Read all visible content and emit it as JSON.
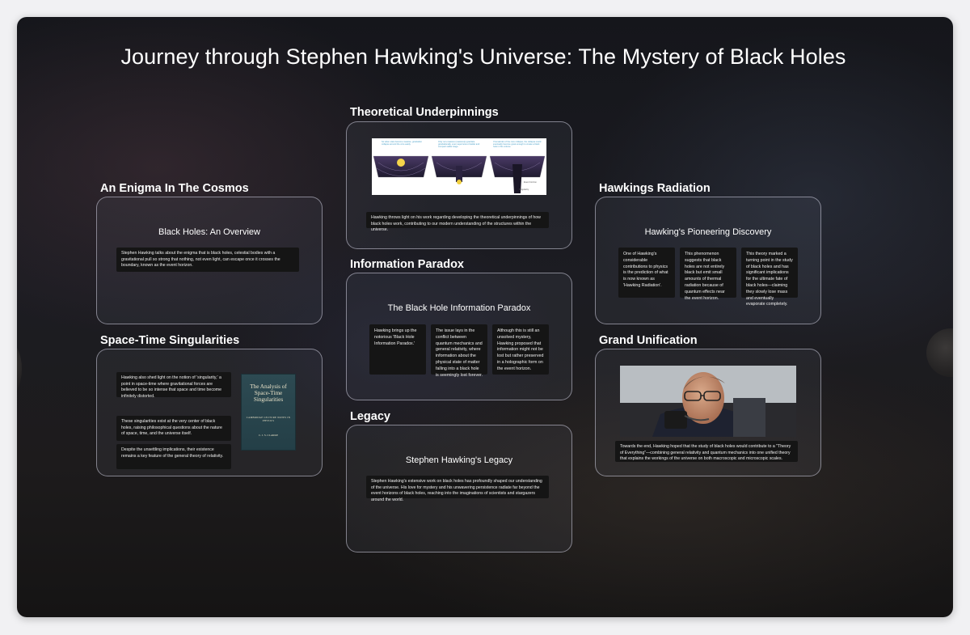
{
  "title": "Journey through Stephen Hawking's Universe: The Mystery of Black Holes",
  "frames": {
    "enigma": {
      "title": "An Enigma In The Cosmos",
      "heading": "Black Holes: An Overview",
      "text": "Stephen Hawking talks about the enigma that is black holes, celestial bodies with a gravitational pull so strong that nothing, not even light, can escape once it crosses the boundary, known as the event horizon."
    },
    "singularities": {
      "title": "Space-Time Singularities",
      "texts": [
        "Hawking also shed light on the notion of 'singularity,' a point in space-time where gravitational forces are believed to be so intense that space and time become infinitely distorted.",
        "These singularities exist at the very center of black holes, raising philosophical questions about the nature of space, time, and the universe itself.",
        "Despite the unsettling implications, their existence remains a key feature of the general theory of relativity."
      ],
      "book": {
        "title": "The Analysis of Space-Time Singularities",
        "subtitle": "CAMBRIDGE LECTURE NOTES IN PHYSICS",
        "author": "C. J. S. CLARKE"
      }
    },
    "theory": {
      "title": "Theoretical Underpinnings",
      "text": "Hawking throws light on his work regarding developing the theoretical underpinnings of how black holes work, contributing to our modern understanding of the structures within the universe.",
      "diagram_captions": [
        "So when stars become massive, gravitation collapse around the core easily.",
        "Only non-massive (massively) gravitate gravitationally, even supernova of stellar and compact stellar stage.",
        "If remainder of the core collapse, the collapse could eventually become great enough to create a black hole in this volume."
      ],
      "diagram_labels": [
        "Event horizon",
        "Singularity"
      ]
    },
    "paradox": {
      "title": "Information Paradox",
      "heading": "The Black Hole Information Paradox",
      "columns": [
        "Hawking brings up the notorious 'Black Hole Information Paradox.'",
        "The issue lays in the conflict between quantum mechanics and general relativity, where information about the physical state of matter falling into a black hole is seemingly lost forever.",
        "Although this is still an unsolved mystery, Hawking proposed that information might not be lost but rather preserved in a holographic form on the event horizon."
      ]
    },
    "legacy": {
      "title": "Legacy",
      "heading": "Stephen Hawking's Legacy",
      "text": "Stephen Hawking's extensive work on black holes has profoundly shaped our understanding of the universe. His love for mystery and his unwavering persistence radiate far beyond the event horizons of black holes, reaching into the imaginations of scientists and stargazers around the world."
    },
    "radiation": {
      "title": "Hawkings Radiation",
      "heading": "Hawking's Pioneering Discovery",
      "columns": [
        "One of Hawking's considerable contributions to physics is the prediction of what is now known as 'Hawking Radiation'.",
        "This phenomenon suggests that black holes are not entirely black but emit small amounts of thermal radiation because of quantum effects near the event horizon.",
        "This theory marked a turning point in the study of black holes and has significant implications for the ultimate fate of black holes—claiming they slowly lose mass and eventually evaporate completely."
      ]
    },
    "unification": {
      "title": "Grand Unification",
      "text": "Towards the end, Hawking hoped that the study of black holes would contribute to a \"Theory of Everything\"—combining general relativity and quantum mechanics into one unified theory that explains the workings of the universe on both macroscopic and microscopic scales."
    }
  },
  "colors": {
    "background": "#1b1b21",
    "frame_border": "#d2d2e1",
    "text_box": "#151515",
    "text": "#ffffff"
  }
}
